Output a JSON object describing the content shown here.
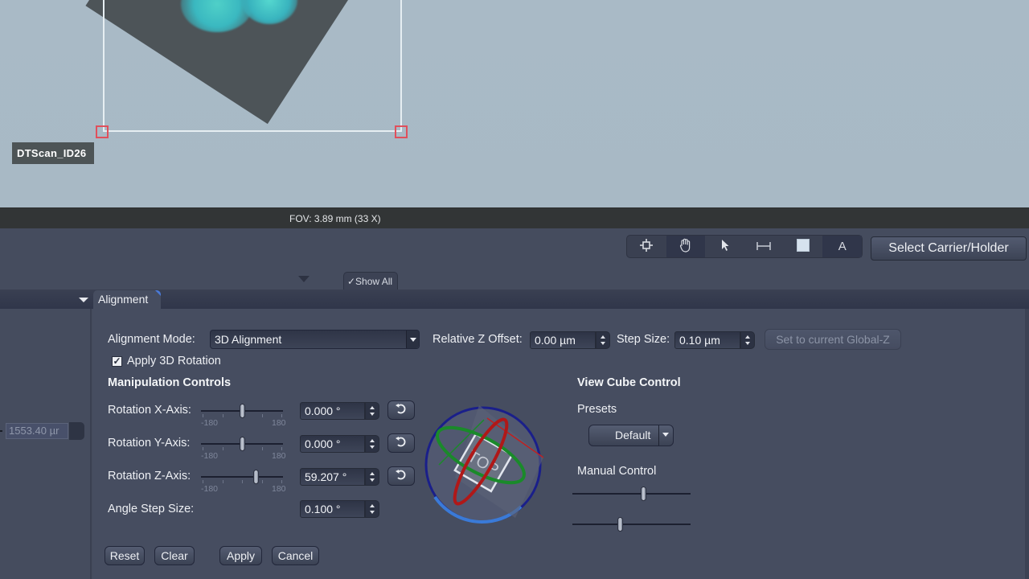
{
  "viewer": {
    "scan_label": "DTScan_ID26",
    "fov_text": "FOV: 3.89 mm (33 X)"
  },
  "toolbar": {
    "tools": [
      {
        "name": "move-stage-icon",
        "glyph": "⌖",
        "active": false
      },
      {
        "name": "pan-hand-icon",
        "glyph": "✋",
        "active": true
      },
      {
        "name": "pointer-icon",
        "glyph": "➤",
        "active": false
      },
      {
        "name": "measure-icon",
        "glyph": "⟷",
        "active": false
      },
      {
        "name": "rectangle-icon",
        "glyph": "■",
        "active": false
      },
      {
        "name": "text-icon",
        "glyph": "A",
        "active": true
      }
    ],
    "select_carrier_label": "Select Carrier/Holder",
    "show_all_label": "✓Show All"
  },
  "tabs": {
    "active": "Alignment"
  },
  "left_panel": {
    "field_value": "1553.40 µr"
  },
  "alignment": {
    "mode_label": "Alignment Mode:",
    "mode_value": "3D Alignment",
    "rel_z_label": "Relative Z Offset:",
    "rel_z_value": "0.00 µm",
    "step_label": "Step Size:",
    "step_value": "0.10 µm",
    "set_global_z_label": "Set to current Global-Z",
    "apply_rotation_label": "Apply 3D Rotation",
    "apply_rotation_checked": true,
    "manipulation_heading": "Manipulation Controls",
    "rotations": [
      {
        "label": "Rotation X-Axis:",
        "value": "0.000 °",
        "numeric": 0.0,
        "min_label": "-180",
        "max_label": "180",
        "min": -180,
        "max": 180
      },
      {
        "label": "Rotation Y-Axis:",
        "value": "0.000 °",
        "numeric": 0.0,
        "min_label": "-180",
        "max_label": "180",
        "min": -180,
        "max": 180
      },
      {
        "label": "Rotation Z-Axis:",
        "value": "59.207 °",
        "numeric": 59.207,
        "min_label": "-180",
        "max_label": "180",
        "min": -180,
        "max": 180
      }
    ],
    "angle_step_label": "Angle Step Size:",
    "angle_step_value": "0.100 °",
    "buttons": {
      "reset": "Reset",
      "clear": "Clear",
      "apply": "Apply",
      "cancel": "Cancel"
    }
  },
  "view_cube": {
    "heading": "View Cube Control",
    "face_label": "TOP",
    "presets_label": "Presets",
    "preset_value": "Default",
    "manual_label": "Manual Control",
    "manual_sliders": [
      0.6,
      0.4
    ]
  },
  "colors": {
    "ring": "#1a1f8a",
    "ring_highlight": "#3a7ad8",
    "x_axis": "#c02020",
    "y_axis": "#1a8a2a",
    "roi_handle": "#e0505c",
    "tab_corner": "#4a7ad8"
  }
}
